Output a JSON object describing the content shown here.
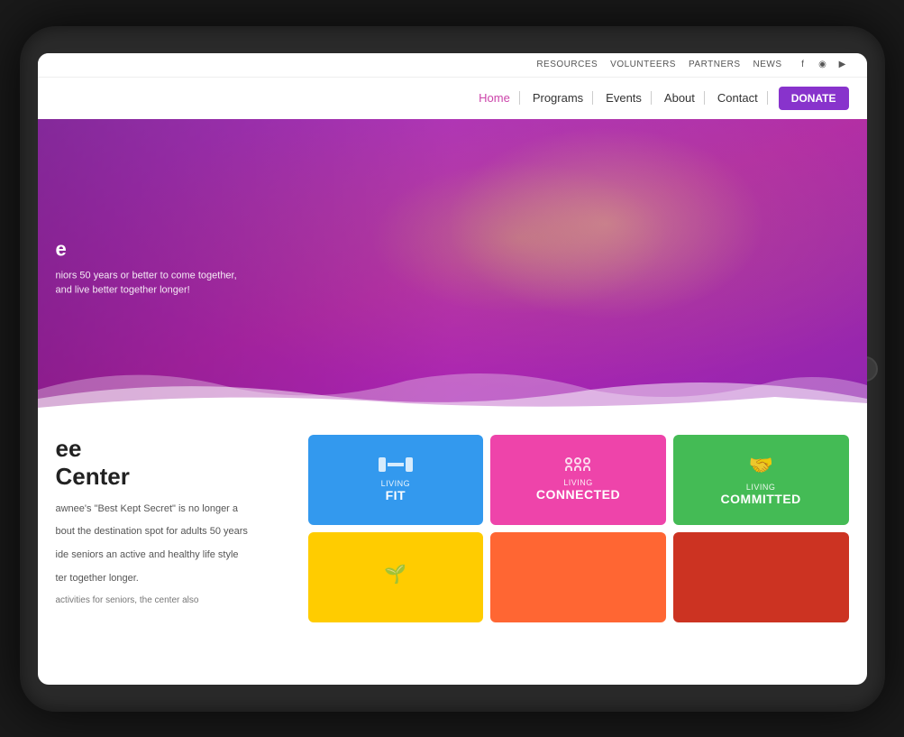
{
  "tablet": {
    "top_nav": {
      "items": [
        "Resources",
        "Volunteers",
        "Partners",
        "News"
      ],
      "social": [
        "f",
        "◉",
        "▶"
      ]
    },
    "main_nav": {
      "items": [
        {
          "label": "Home",
          "active": true
        },
        {
          "label": "Programs",
          "active": false
        },
        {
          "label": "Events",
          "active": false
        },
        {
          "label": "About",
          "active": false
        },
        {
          "label": "Contact",
          "active": false
        }
      ],
      "donate_label": "DONATE"
    },
    "hero": {
      "title": "e",
      "subtitle_line1": "niors 50 years or better to come together,",
      "subtitle_line2": "and live better together longer!"
    },
    "content": {
      "title_line1": "ee",
      "title_line2": "Center",
      "paragraph1": "awnee's \"Best Kept Secret\" is no longer a",
      "paragraph2": "bout the destination spot for adults 50 years",
      "paragraph3": "ide seniors an active and healthy life style",
      "paragraph4": "ter together longer.",
      "paragraph5": "activities for seniors, the center also"
    },
    "cards": [
      {
        "id": "fit",
        "color": "blue",
        "label": "Living",
        "title": "FIT",
        "icon": "dumbbell"
      },
      {
        "id": "connected",
        "color": "pink",
        "label": "Living",
        "title": "CONNECTED",
        "icon": "people"
      },
      {
        "id": "committed",
        "color": "green",
        "label": "Living",
        "title": "COMMITTED",
        "icon": "hand"
      },
      {
        "id": "card4",
        "color": "yellow",
        "label": "",
        "title": "",
        "icon": "leaf"
      },
      {
        "id": "card5",
        "color": "orange",
        "label": "",
        "title": "",
        "icon": ""
      },
      {
        "id": "card6",
        "color": "red",
        "label": "",
        "title": "",
        "icon": ""
      }
    ]
  }
}
